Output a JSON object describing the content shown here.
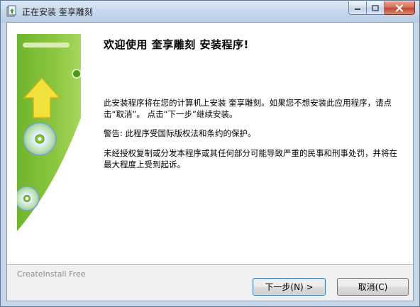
{
  "window": {
    "title": "正在安装 奎享雕刻"
  },
  "welcome": {
    "heading": "欢迎使用 奎享雕刻 安装程序!",
    "paragraph1": "此安装程序将在您的计算机上安装 奎享雕刻。如果您不想安装此应用程序，请点击“取消”。 点击“下一步”继续安装。",
    "paragraph2": "警告: 此程序受国际版权法和条约的保护。",
    "paragraph3": "未经授权复制或分发本程序或其任何部分可能导致严重的民事和刑事处罚，并将在最大程度上受到起诉。"
  },
  "footer": {
    "brand": "CreateInstall Free",
    "next_label": "下一步(N) >",
    "cancel_label": "取消(C)"
  },
  "colors": {
    "panel_green": "#8cc63f",
    "arrow_yellow": "#f2e13a",
    "close_red": "#c8523a"
  },
  "icons": [
    "app-icon",
    "minimize-icon",
    "maximize-icon",
    "close-icon",
    "cd-disc-icon",
    "upload-arrow-icon"
  ]
}
